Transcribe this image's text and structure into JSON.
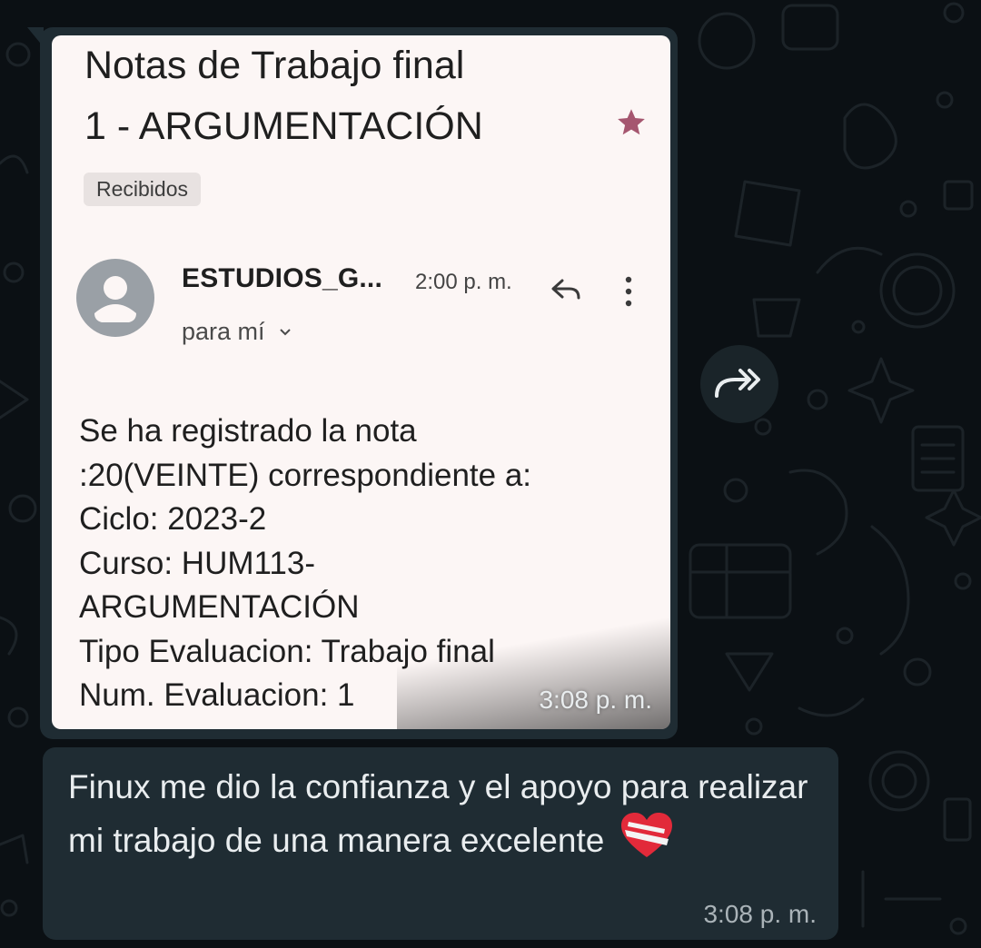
{
  "email": {
    "subject_line1": "Notas de Trabajo final",
    "subject_line2": "1 - ARGUMENTACIÓN",
    "label_chip": "Recibidos",
    "sender": "ESTUDIOS_G...",
    "time": "2:00 p. m.",
    "recipient": "para mí",
    "body_lines": [
      "Se ha registrado la nota",
      ":20(VEINTE) correspondiente a:",
      "Ciclo: 2023-2",
      "Curso: HUM113-",
      "ARGUMENTACIÓN",
      "Tipo Evaluacion: Trabajo final",
      "Num. Evaluacion: 1"
    ]
  },
  "image_message": {
    "time": "3:08 p. m."
  },
  "text_message": {
    "text": "Finux me dio la confianza y el apoyo para realizar mi trabajo de una manera excelente",
    "time": "3:08 p. m."
  },
  "icons": {
    "star": "star-icon",
    "reply": "reply-icon",
    "more": "more-vert-icon",
    "forward": "forward-icon",
    "heart": "mending-heart-emoji"
  },
  "colors": {
    "background": "#0b1014",
    "bubble": "#1f2c33",
    "email_bg": "#fcf6f5",
    "star": "#a5566f",
    "message_text": "#e9edef"
  }
}
